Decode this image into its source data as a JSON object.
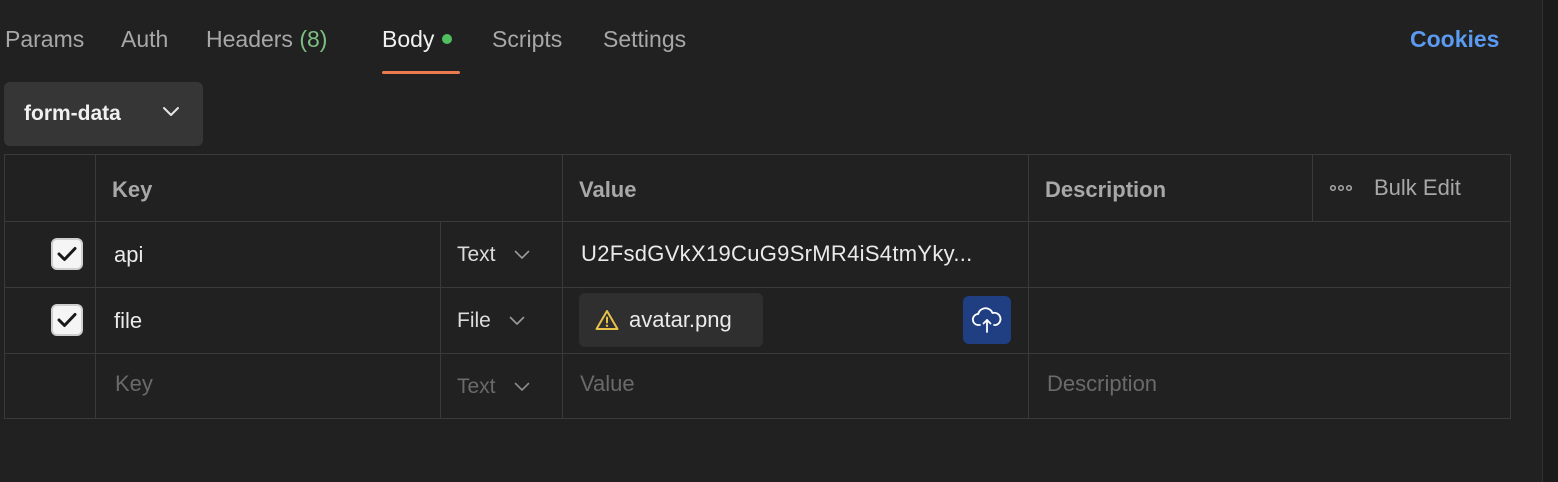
{
  "tabs": [
    {
      "label": "Params",
      "active": false
    },
    {
      "label": "Auth",
      "active": false
    },
    {
      "label": "Headers",
      "count": "(8)",
      "active": false
    },
    {
      "label": "Body",
      "active": true,
      "indicator_color": "#4fbf5f"
    },
    {
      "label": "Scripts",
      "active": false
    },
    {
      "label": "Settings",
      "active": false
    }
  ],
  "cookies_label": "Cookies",
  "body_mode": {
    "selected": "form-data",
    "icon": "chevron-down-icon"
  },
  "table": {
    "headers": {
      "key": "Key",
      "value": "Value",
      "description": "Description"
    },
    "bulk_edit": {
      "label": "Bulk Edit",
      "icon": "more-horizontal-icon"
    },
    "rows": [
      {
        "checked": true,
        "key": "api",
        "type": "Text",
        "value": "U2FsdGVkX19CuG9SrMR4iS4tmYky...",
        "description": ""
      },
      {
        "checked": true,
        "key": "file",
        "type": "File",
        "value": "avatar.png",
        "value_icon": "warning-icon",
        "upload_icon": "cloud-upload-icon",
        "description": ""
      }
    ],
    "new_row": {
      "key_placeholder": "Key",
      "type": "Text",
      "value_placeholder": "Value",
      "description_placeholder": "Description"
    }
  },
  "colors": {
    "accent_tab": "#ec7a50",
    "link": "#5a9af0",
    "upload_button": "#1f3f82",
    "count": "#7dbf82"
  }
}
